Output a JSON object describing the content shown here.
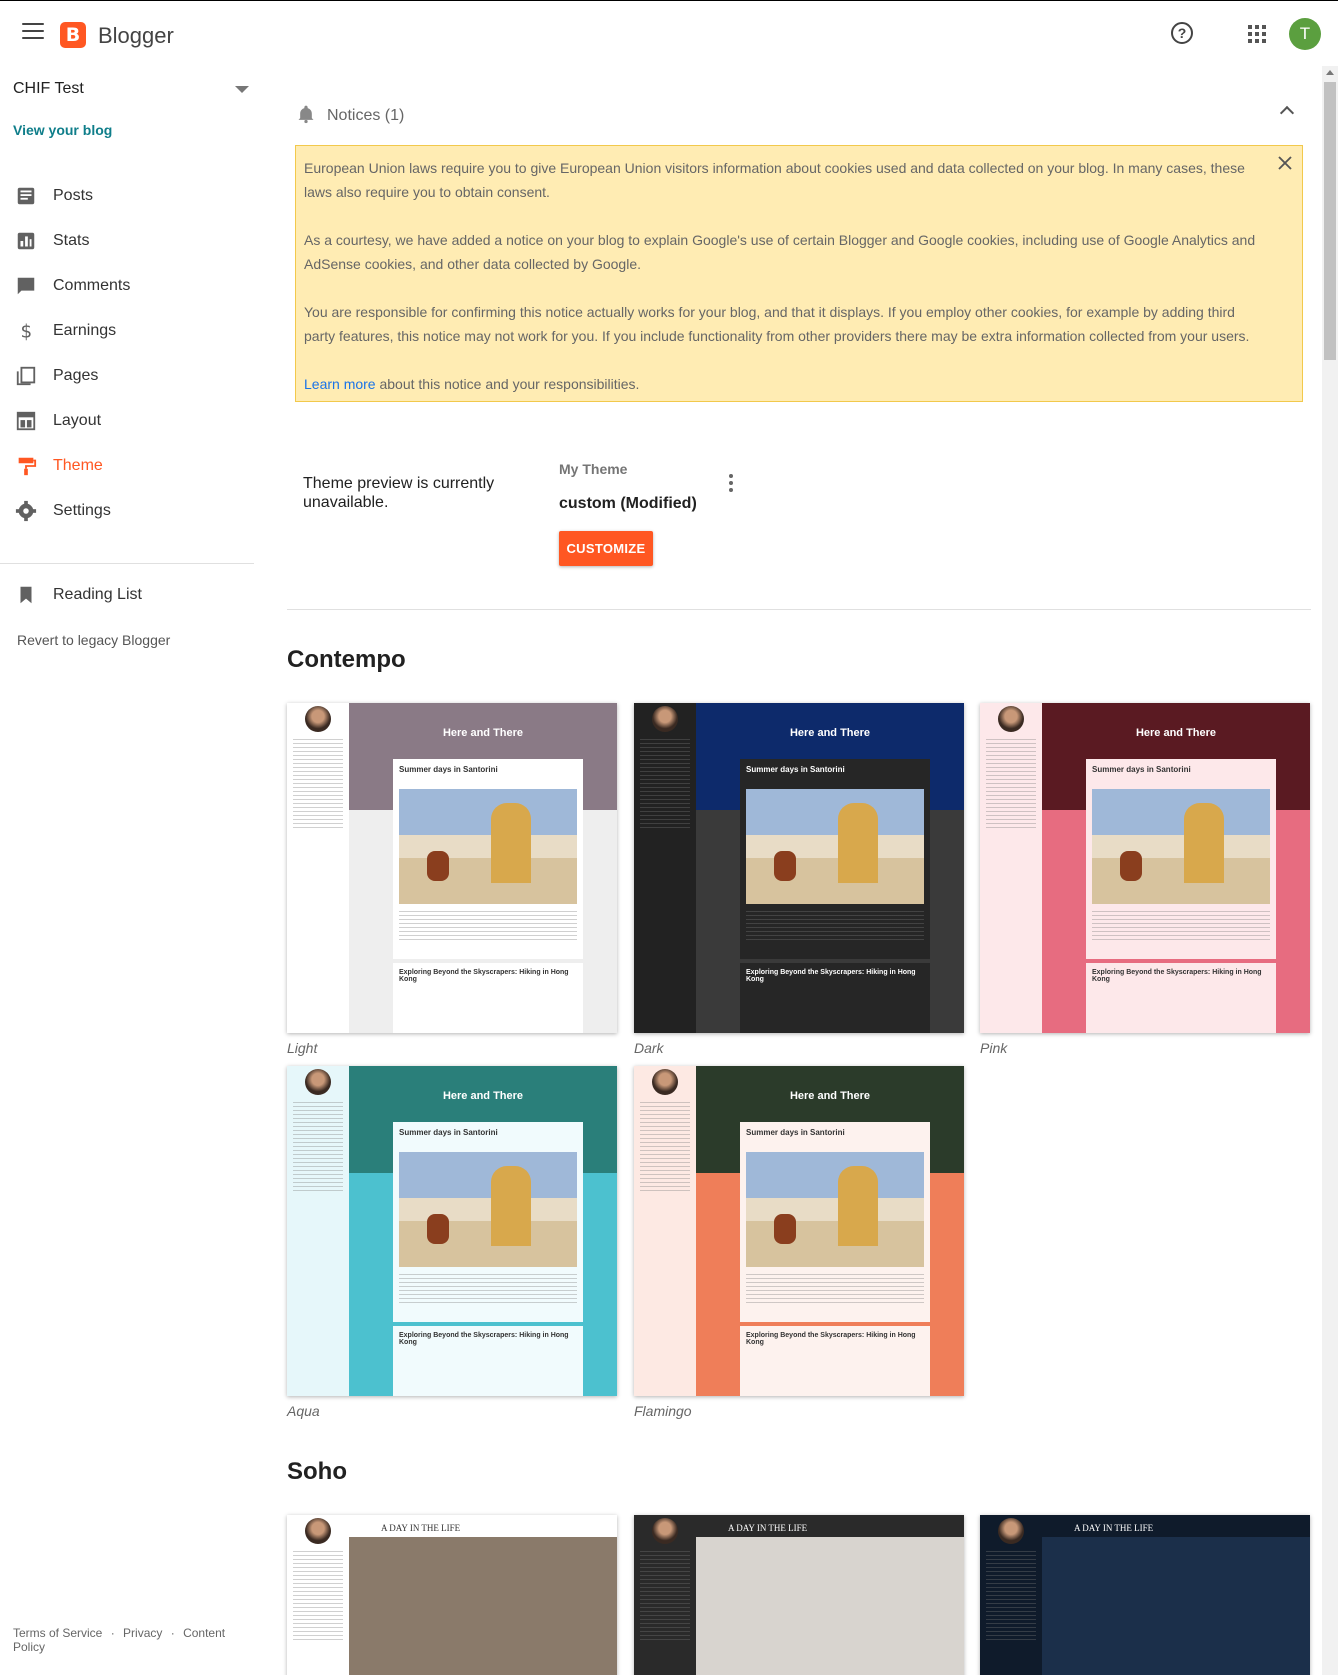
{
  "header": {
    "brand": "Blogger",
    "logo_letter": "B",
    "avatar_letter": "T"
  },
  "sidebar": {
    "blog_name": "CHIF Test",
    "view_blog": "View your blog",
    "items": [
      {
        "label": "Posts",
        "icon": "posts-icon"
      },
      {
        "label": "Stats",
        "icon": "stats-icon"
      },
      {
        "label": "Comments",
        "icon": "comments-icon"
      },
      {
        "label": "Earnings",
        "icon": "earnings-icon"
      },
      {
        "label": "Pages",
        "icon": "pages-icon"
      },
      {
        "label": "Layout",
        "icon": "layout-icon"
      },
      {
        "label": "Theme",
        "icon": "theme-icon",
        "active": true
      },
      {
        "label": "Settings",
        "icon": "settings-icon"
      },
      {
        "label": "Reading List",
        "icon": "reading-list-icon"
      }
    ],
    "revert": "Revert to legacy Blogger",
    "footer": {
      "terms": "Terms of Service",
      "privacy": "Privacy",
      "content": "Content Policy",
      "sep": "·"
    }
  },
  "notices": {
    "title": "Notices (1)",
    "p1": "European Union laws require you to give European Union visitors information about cookies used and data collected on your blog. In many cases, these laws also require you to obtain consent.",
    "p2": "As a courtesy, we have added a notice on your blog to explain Google's use of certain Blogger and Google cookies, including use of Google Analytics and AdSense cookies, and other data collected by Google.",
    "p3": "You are responsible for confirming this notice actually works for your blog, and that it displays. If you employ other cookies, for example by adding third party features, this notice may not work for you. If you include functionality from other providers there may be extra information collected from your users.",
    "learn_more": "Learn more",
    "p4_rest": " about this notice and your responsibilities."
  },
  "current_theme": {
    "preview_msg": "Theme preview is currently unavailable.",
    "label": "My Theme",
    "name": "custom (Modified)",
    "customize": "CUSTOMIZE"
  },
  "gallery": {
    "contempo": {
      "title": "Contempo",
      "blog_title": "Here and There",
      "post1": "Summer days in Santorini",
      "post2": "Exploring Beyond the Skyscrapers: Hiking in Hong Kong",
      "themes": [
        {
          "name": "Light",
          "side": "#ffffff",
          "banner": "#8a7a86",
          "lower": "#eeeeee",
          "card": "#ffffff",
          "ink": "#333333"
        },
        {
          "name": "Dark",
          "side": "#222222",
          "banner": "#0d2a6b",
          "lower": "#3a3a3a",
          "card": "#262626",
          "ink": "#ffffff"
        },
        {
          "name": "Pink",
          "side": "#fde8ea",
          "banner": "#5a1a22",
          "lower": "#e76c80",
          "card": "#fde8ea",
          "ink": "#333333"
        },
        {
          "name": "Aqua",
          "side": "#e6f7fa",
          "banner": "#2a7f7a",
          "lower": "#4cc1cf",
          "card": "#f1fbfd",
          "ink": "#333333"
        },
        {
          "name": "Flamingo",
          "side": "#fde9e3",
          "banner": "#2b3b2a",
          "lower": "#ef7e59",
          "card": "#fdf2ee",
          "ink": "#333333"
        }
      ]
    },
    "soho": {
      "title": "Soho",
      "blog_title": "A DAY IN THE LIFE",
      "themes": [
        {
          "side": "#ffffff",
          "top": "#ffffff",
          "img": "#8a7a6a",
          "ink": "#333333"
        },
        {
          "side": "#2a2a2a",
          "top": "#2a2a2a",
          "img": "#d8d4cf",
          "ink": "#ffffff"
        },
        {
          "side": "#0f1b2b",
          "top": "#0f1b2b",
          "img": "#1b2f4a",
          "ink": "#ffffff"
        }
      ]
    }
  }
}
